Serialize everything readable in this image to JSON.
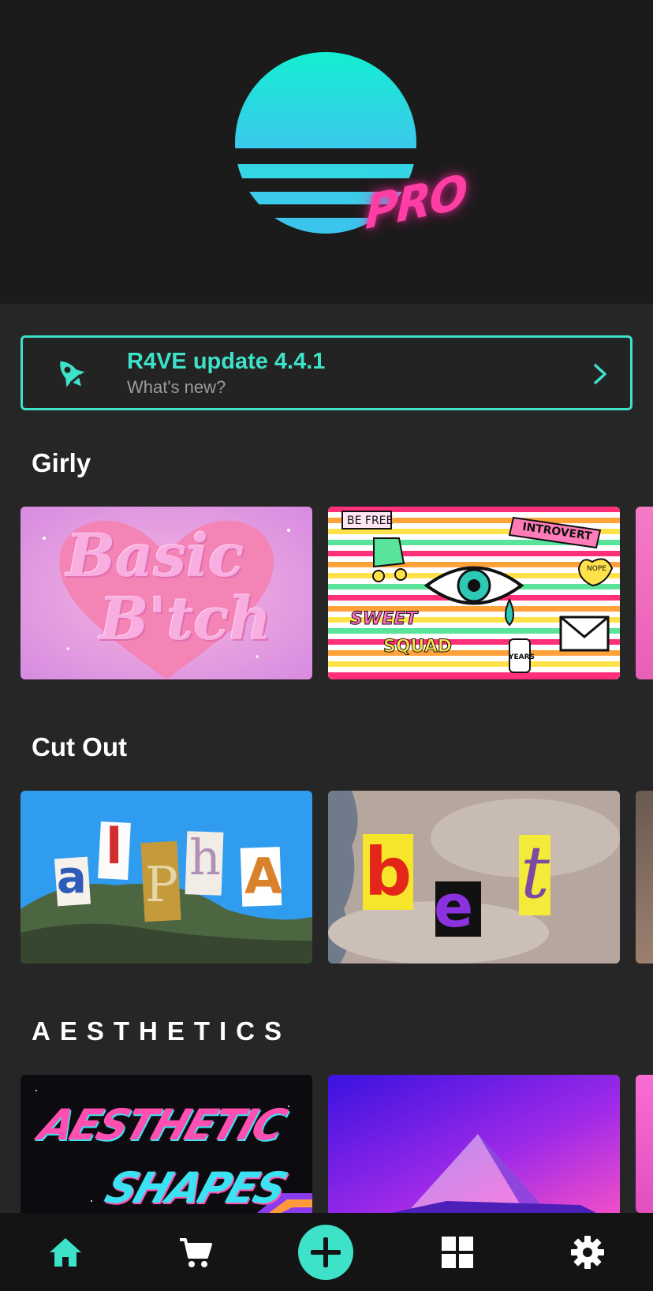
{
  "header": {
    "logo_badge": "PRO",
    "accent_color": "#3de2c9",
    "badge_color": "#ff3ea5"
  },
  "update_banner": {
    "title": "R4VE update 4.4.1",
    "subtitle": "What's new?",
    "icon": "rocket-icon"
  },
  "sections": [
    {
      "title": "Girly",
      "cards": [
        {
          "line1": "Basic",
          "line2": "B'tch"
        },
        {
          "tags": [
            "BE FREE",
            "INTROVERT",
            "SWEET",
            "SQUAD",
            "NOPE",
            "YEARS"
          ]
        }
      ]
    },
    {
      "title": "Cut Out",
      "cards": [
        {
          "letters": [
            "a",
            "l",
            "P",
            "h",
            "A"
          ]
        },
        {
          "letters": [
            "b",
            "e",
            "t"
          ]
        }
      ]
    },
    {
      "title": "AESTHETICS",
      "cards": [
        {
          "line1": "AESTHETIC",
          "line2": "SHAPES"
        },
        {
          "description": ""
        }
      ]
    }
  ],
  "nav": {
    "items": [
      {
        "name": "home",
        "icon": "home-icon",
        "active": true
      },
      {
        "name": "shop",
        "icon": "cart-icon"
      },
      {
        "name": "create",
        "icon": "plus-icon"
      },
      {
        "name": "templates",
        "icon": "grid-icon"
      },
      {
        "name": "settings",
        "icon": "gear-icon"
      }
    ]
  }
}
